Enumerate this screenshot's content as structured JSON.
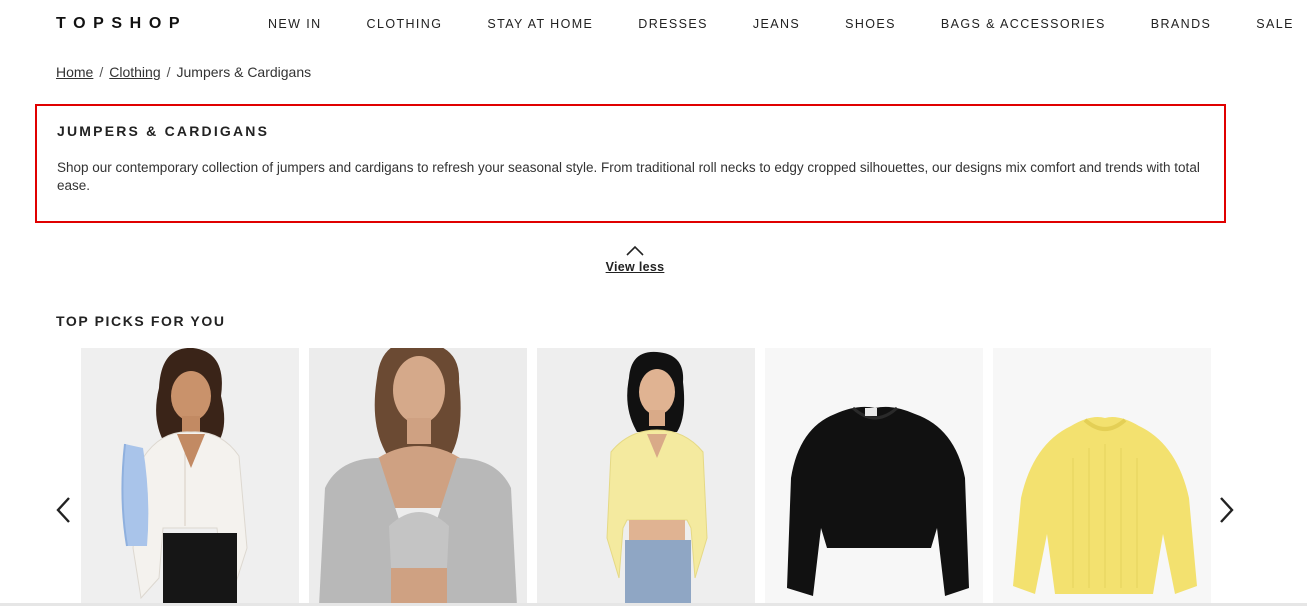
{
  "brand": {
    "logo": "TOPSHOP"
  },
  "nav": {
    "items": [
      {
        "label": "NEW IN"
      },
      {
        "label": "CLOTHING"
      },
      {
        "label": "STAY AT HOME"
      },
      {
        "label": "DRESSES"
      },
      {
        "label": "JEANS"
      },
      {
        "label": "SHOES"
      },
      {
        "label": "BAGS & ACCESSORIES"
      },
      {
        "label": "BRANDS"
      },
      {
        "label": "SALE"
      }
    ]
  },
  "breadcrumb": {
    "items": [
      {
        "label": "Home"
      },
      {
        "label": "Clothing"
      },
      {
        "label": "Jumpers & Cardigans"
      }
    ],
    "separator": "/"
  },
  "category": {
    "title": "JUMPERS & CARDIGANS",
    "description": "Shop our contemporary collection of jumpers and cardigans to refresh your seasonal style. From traditional roll necks to edgy cropped silhouettes, our designs mix comfort and trends with total ease.",
    "highlight_color": "#e00000",
    "toggle_label": "View less",
    "toggle_icon": "chevron-up-icon"
  },
  "top_picks": {
    "title": "TOP PICKS FOR YOU",
    "prev_icon": "chevron-left-icon",
    "next_icon": "chevron-right-icon",
    "products": [
      {
        "image": "white cropped cardigan on model"
      },
      {
        "image": "grey knit cardigan and bralette on model"
      },
      {
        "image": "yellow cropped cardigan on model"
      },
      {
        "image": "black cropped jumper"
      },
      {
        "image": "yellow knit jumper"
      }
    ]
  }
}
